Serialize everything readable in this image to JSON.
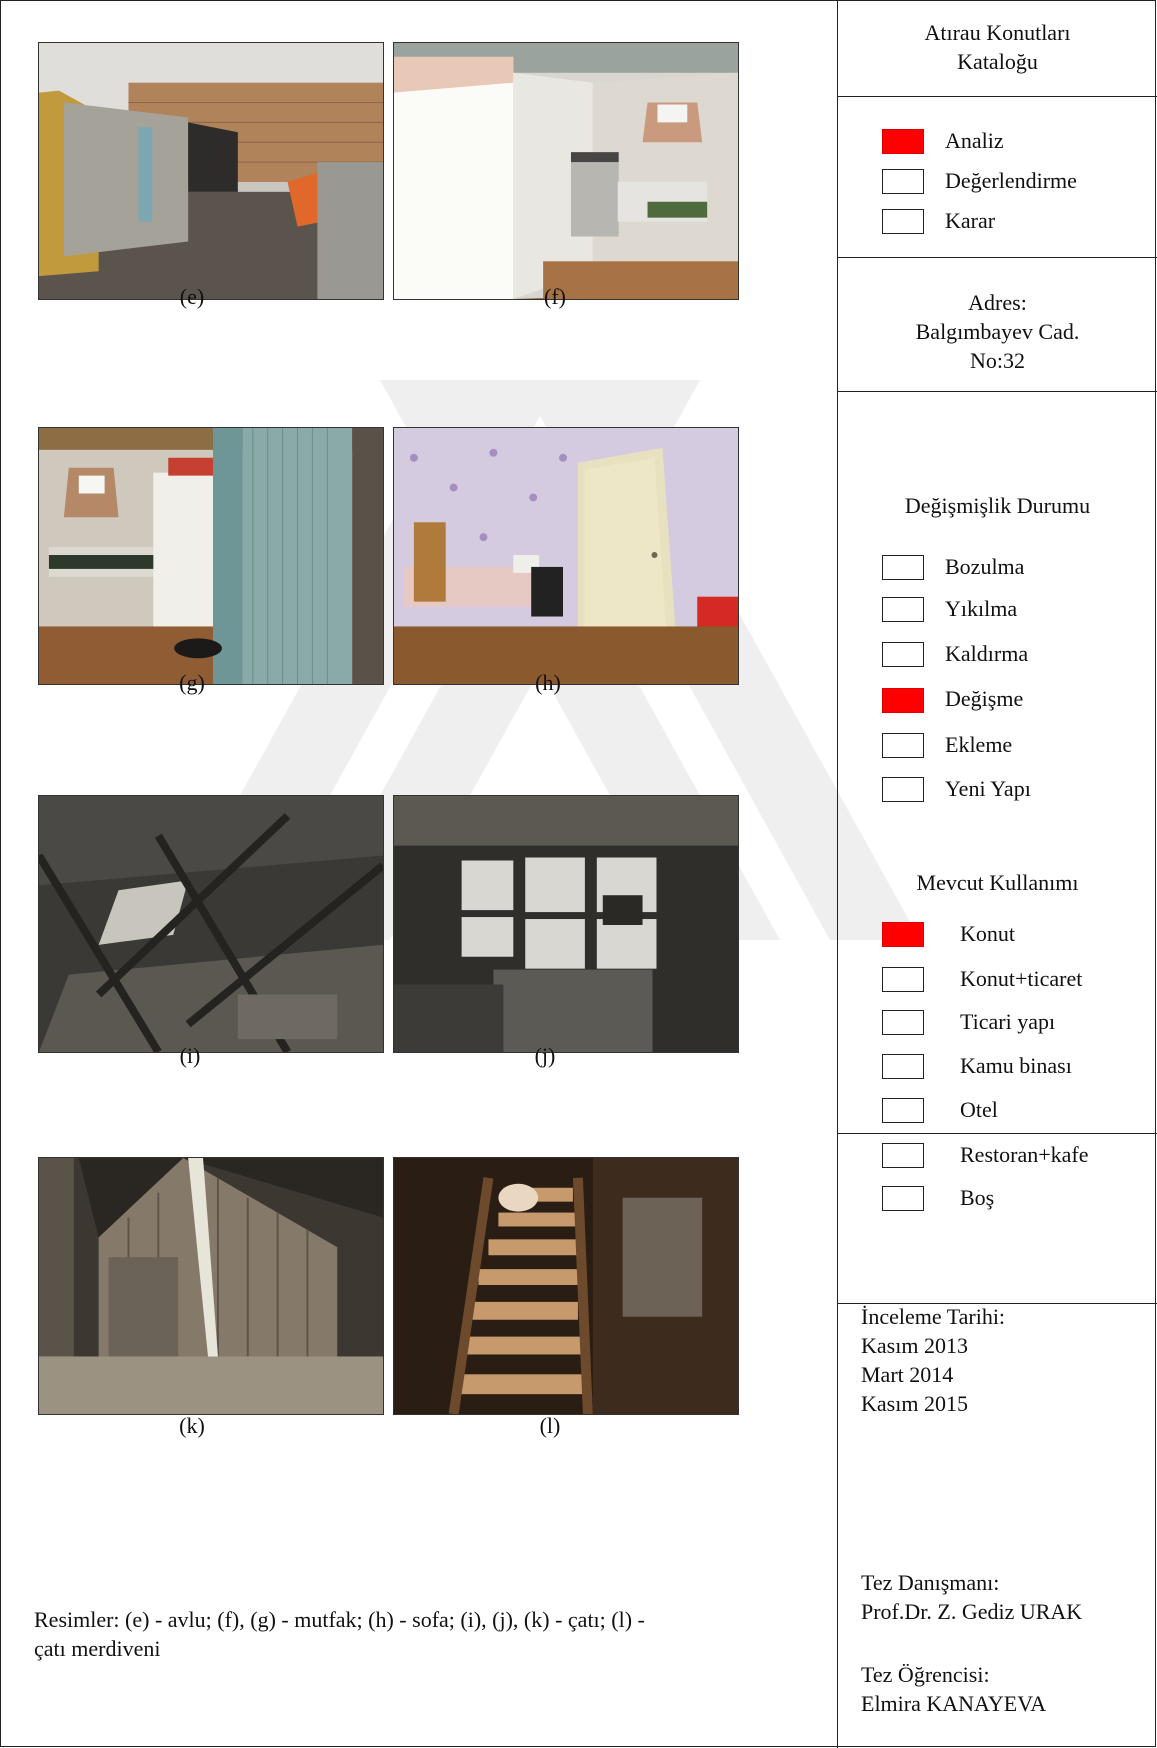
{
  "header": {
    "title_line1": "Atırau Konutları",
    "title_line2": "Kataloğu"
  },
  "stage": [
    {
      "label": "Analiz",
      "checked": true
    },
    {
      "label": "Değerlendirme",
      "checked": false
    },
    {
      "label": "Karar",
      "checked": false
    }
  ],
  "address": {
    "line1": "Adres:",
    "line2": "Balgımbayev Cad.",
    "line3": "No:32"
  },
  "change_status": {
    "title": "Değişmişlik Durumu",
    "items": [
      {
        "label": "Bozulma",
        "checked": false
      },
      {
        "label": "Yıkılma",
        "checked": false
      },
      {
        "label": "Kaldırma",
        "checked": false
      },
      {
        "label": "Değişme",
        "checked": true
      },
      {
        "label": "Ekleme",
        "checked": false
      },
      {
        "label": "Yeni Yapı",
        "checked": false
      }
    ]
  },
  "current_use": {
    "title": "Mevcut Kullanımı",
    "items": [
      {
        "label": "Konut",
        "checked": true
      },
      {
        "label": "Konut+ticaret",
        "checked": false
      },
      {
        "label": "Ticari yapı",
        "checked": false
      },
      {
        "label": "Kamu binası",
        "checked": false
      },
      {
        "label": "Otel",
        "checked": false
      },
      {
        "label": "Restoran+kafe",
        "checked": false
      },
      {
        "label": "Boş",
        "checked": false
      }
    ]
  },
  "inspection": {
    "title": "İnceleme Tarihi:",
    "dates": [
      "Kasım 2013",
      "Mart 2014",
      "Kasım 2015"
    ]
  },
  "advisor": {
    "title": "Tez Danışmanı:",
    "name": "Prof.Dr. Z. Gediz URAK"
  },
  "student": {
    "title": "Tez Öğrencisi:",
    "name": "Elmira KANAYEVA"
  },
  "photos": [
    {
      "caption": "(e)"
    },
    {
      "caption": "(f)"
    },
    {
      "caption": "(g)"
    },
    {
      "caption": "(h)"
    },
    {
      "caption": "(i)"
    },
    {
      "caption": "(j)"
    },
    {
      "caption": "(k)"
    },
    {
      "caption": "(l)"
    }
  ],
  "footnote": {
    "line1": "Resimler: (e) - avlu; (f), (g) - mutfak; (h) - sofa; (i), (j), (k) - çatı; (l) -",
    "line2": "çatı merdiveni"
  },
  "colors": {
    "checked": "#ff0000",
    "border": "#222222",
    "watermark": "#ececec"
  }
}
